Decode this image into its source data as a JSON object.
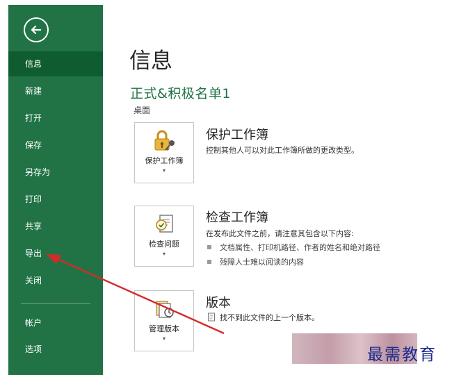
{
  "sidebar": {
    "items": [
      {
        "id": "info",
        "label": "信息",
        "active": true
      },
      {
        "id": "new",
        "label": "新建"
      },
      {
        "id": "open",
        "label": "打开"
      },
      {
        "id": "save",
        "label": "保存"
      },
      {
        "id": "save-as",
        "label": "另存为"
      },
      {
        "id": "print",
        "label": "打印"
      },
      {
        "id": "share",
        "label": "共享"
      },
      {
        "id": "export",
        "label": "导出"
      },
      {
        "id": "close",
        "label": "关闭"
      }
    ],
    "bottom_items": [
      {
        "id": "account",
        "label": "帐户"
      },
      {
        "id": "options",
        "label": "选项"
      }
    ]
  },
  "main": {
    "title": "信息",
    "doc_name": "正式&积极名单1",
    "doc_location": "桌面",
    "sections": {
      "protect": {
        "tile_label": "保护工作簿",
        "title": "保护工作簿",
        "description": "控制其他人可以对此工作簿所做的更改类型。"
      },
      "inspect": {
        "tile_label": "检查问题",
        "title": "检查工作簿",
        "description": "在发布此文件之前，请注意其包含以下内容:",
        "bullets": [
          "文档属性、打印机路径、作者的姓名和绝对路径",
          "残障人士难以阅读的内容"
        ]
      },
      "versions": {
        "tile_label": "管理版本",
        "title": "版本",
        "description": "找不到此文件的上一个版本。"
      }
    }
  },
  "watermark": {
    "text": "最需教育"
  },
  "colors": {
    "sidebar": "#217346",
    "sidebar_active": "#0e5c2f",
    "accent": "#217346",
    "annotation": "#d42a2a"
  }
}
